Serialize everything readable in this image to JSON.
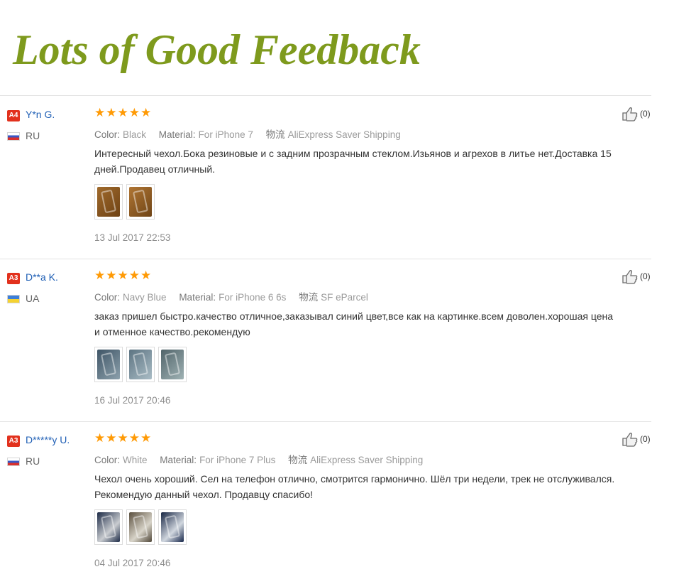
{
  "banner": {
    "title": "Lots of Good Feedback"
  },
  "icons": {
    "rating": "star-icon",
    "helpful": "thumbs-up-icon",
    "flag": "country-flag-icon"
  },
  "colors": {
    "title": "#7e9a1d",
    "star": "#ff9a05",
    "badge": "#e2311d",
    "username": "#1f5fb5"
  },
  "reviews": [
    {
      "level": "A4",
      "user": "Y*n G.",
      "country": "RU",
      "stars": 5,
      "color_label": "Color:",
      "color_value": "Black",
      "material_label": "Material:",
      "material_value": "For iPhone 7",
      "shipping_label": "物流",
      "shipping_value": "AliExpress Saver Shipping",
      "comment": "Интересный чехол.Бока резиновые и с задним прозрачным стеклом.Изьянов и агрехов в литье нет.Доставка 15 дней.Продавец отличный.",
      "photos": [
        "#8a5a25",
        "#94622c"
      ],
      "date": "13 Jul 2017 22:53",
      "helpful": "(0)"
    },
    {
      "level": "A3",
      "user": "D**a K.",
      "country": "UA",
      "stars": 5,
      "color_label": "Color:",
      "color_value": "Navy Blue",
      "material_label": "Material:",
      "material_value": "For iPhone 6 6s",
      "shipping_label": "物流",
      "shipping_value": "SF eParcel",
      "comment": "заказ пришел быстро.качество отличное,заказывал синий цвет,все как на картинке.всем доволен.хорошая цена и отменное качество.рекомендую",
      "photos": [
        "#4f6170",
        "#6a7f8c",
        "#5d6f74"
      ],
      "date": "16 Jul 2017 20:46",
      "helpful": "(0)"
    },
    {
      "level": "A3",
      "user": "D*****y U.",
      "country": "RU",
      "stars": 5,
      "color_label": "Color:",
      "color_value": "White",
      "material_label": "Material:",
      "material_value": "For iPhone 7 Plus",
      "shipping_label": "物流",
      "shipping_value": "AliExpress Saver Shipping",
      "comment": "Чехол очень хороший. Сел на телефон отлично, смотрится гармонично. Шёл три недели, трек не отслуживался. Рекомендую данный чехол. Продавцу спасибо!",
      "photos": [
        "#24324d",
        "#6d6250",
        "#1f2d4a"
      ],
      "date": "04 Jul 2017 20:46",
      "helpful": "(0)"
    }
  ]
}
